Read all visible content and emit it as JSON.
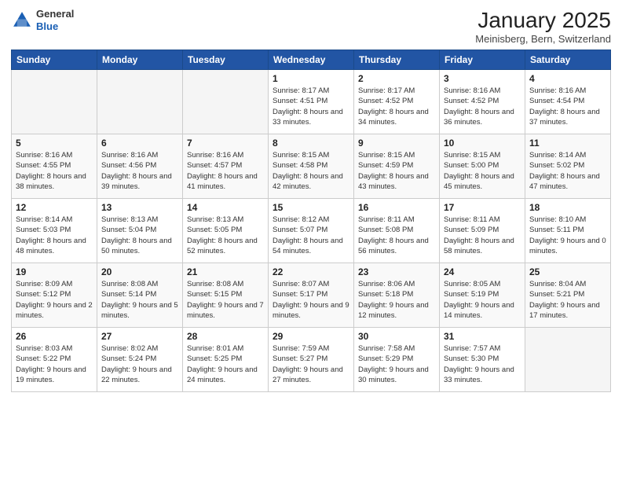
{
  "logo": {
    "general": "General",
    "blue": "Blue"
  },
  "title": "January 2025",
  "location": "Meinisberg, Bern, Switzerland",
  "weekdays": [
    "Sunday",
    "Monday",
    "Tuesday",
    "Wednesday",
    "Thursday",
    "Friday",
    "Saturday"
  ],
  "weeks": [
    [
      {
        "day": null
      },
      {
        "day": null
      },
      {
        "day": null
      },
      {
        "day": 1,
        "sunrise": "8:17 AM",
        "sunset": "4:51 PM",
        "daylight": "8 hours and 33 minutes."
      },
      {
        "day": 2,
        "sunrise": "8:17 AM",
        "sunset": "4:52 PM",
        "daylight": "8 hours and 34 minutes."
      },
      {
        "day": 3,
        "sunrise": "8:16 AM",
        "sunset": "4:52 PM",
        "daylight": "8 hours and 36 minutes."
      },
      {
        "day": 4,
        "sunrise": "8:16 AM",
        "sunset": "4:54 PM",
        "daylight": "8 hours and 37 minutes."
      }
    ],
    [
      {
        "day": 5,
        "sunrise": "8:16 AM",
        "sunset": "4:55 PM",
        "daylight": "8 hours and 38 minutes."
      },
      {
        "day": 6,
        "sunrise": "8:16 AM",
        "sunset": "4:56 PM",
        "daylight": "8 hours and 39 minutes."
      },
      {
        "day": 7,
        "sunrise": "8:16 AM",
        "sunset": "4:57 PM",
        "daylight": "8 hours and 41 minutes."
      },
      {
        "day": 8,
        "sunrise": "8:15 AM",
        "sunset": "4:58 PM",
        "daylight": "8 hours and 42 minutes."
      },
      {
        "day": 9,
        "sunrise": "8:15 AM",
        "sunset": "4:59 PM",
        "daylight": "8 hours and 43 minutes."
      },
      {
        "day": 10,
        "sunrise": "8:15 AM",
        "sunset": "5:00 PM",
        "daylight": "8 hours and 45 minutes."
      },
      {
        "day": 11,
        "sunrise": "8:14 AM",
        "sunset": "5:02 PM",
        "daylight": "8 hours and 47 minutes."
      }
    ],
    [
      {
        "day": 12,
        "sunrise": "8:14 AM",
        "sunset": "5:03 PM",
        "daylight": "8 hours and 48 minutes."
      },
      {
        "day": 13,
        "sunrise": "8:13 AM",
        "sunset": "5:04 PM",
        "daylight": "8 hours and 50 minutes."
      },
      {
        "day": 14,
        "sunrise": "8:13 AM",
        "sunset": "5:05 PM",
        "daylight": "8 hours and 52 minutes."
      },
      {
        "day": 15,
        "sunrise": "8:12 AM",
        "sunset": "5:07 PM",
        "daylight": "8 hours and 54 minutes."
      },
      {
        "day": 16,
        "sunrise": "8:11 AM",
        "sunset": "5:08 PM",
        "daylight": "8 hours and 56 minutes."
      },
      {
        "day": 17,
        "sunrise": "8:11 AM",
        "sunset": "5:09 PM",
        "daylight": "8 hours and 58 minutes."
      },
      {
        "day": 18,
        "sunrise": "8:10 AM",
        "sunset": "5:11 PM",
        "daylight": "9 hours and 0 minutes."
      }
    ],
    [
      {
        "day": 19,
        "sunrise": "8:09 AM",
        "sunset": "5:12 PM",
        "daylight": "9 hours and 2 minutes."
      },
      {
        "day": 20,
        "sunrise": "8:08 AM",
        "sunset": "5:14 PM",
        "daylight": "9 hours and 5 minutes."
      },
      {
        "day": 21,
        "sunrise": "8:08 AM",
        "sunset": "5:15 PM",
        "daylight": "9 hours and 7 minutes."
      },
      {
        "day": 22,
        "sunrise": "8:07 AM",
        "sunset": "5:17 PM",
        "daylight": "9 hours and 9 minutes."
      },
      {
        "day": 23,
        "sunrise": "8:06 AM",
        "sunset": "5:18 PM",
        "daylight": "9 hours and 12 minutes."
      },
      {
        "day": 24,
        "sunrise": "8:05 AM",
        "sunset": "5:19 PM",
        "daylight": "9 hours and 14 minutes."
      },
      {
        "day": 25,
        "sunrise": "8:04 AM",
        "sunset": "5:21 PM",
        "daylight": "9 hours and 17 minutes."
      }
    ],
    [
      {
        "day": 26,
        "sunrise": "8:03 AM",
        "sunset": "5:22 PM",
        "daylight": "9 hours and 19 minutes."
      },
      {
        "day": 27,
        "sunrise": "8:02 AM",
        "sunset": "5:24 PM",
        "daylight": "9 hours and 22 minutes."
      },
      {
        "day": 28,
        "sunrise": "8:01 AM",
        "sunset": "5:25 PM",
        "daylight": "9 hours and 24 minutes."
      },
      {
        "day": 29,
        "sunrise": "7:59 AM",
        "sunset": "5:27 PM",
        "daylight": "9 hours and 27 minutes."
      },
      {
        "day": 30,
        "sunrise": "7:58 AM",
        "sunset": "5:29 PM",
        "daylight": "9 hours and 30 minutes."
      },
      {
        "day": 31,
        "sunrise": "7:57 AM",
        "sunset": "5:30 PM",
        "daylight": "9 hours and 33 minutes."
      },
      {
        "day": null
      }
    ]
  ]
}
